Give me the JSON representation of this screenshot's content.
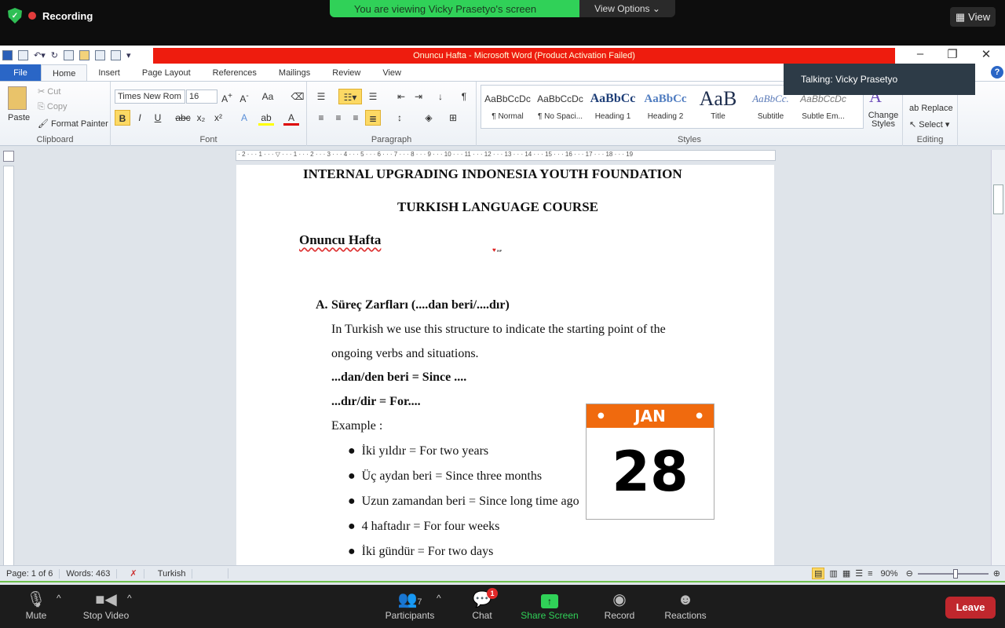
{
  "zoom_top": {
    "recording": "Recording",
    "banner": "You are viewing Vicky Prasetyo's screen",
    "view_options": "View Options",
    "view": "View"
  },
  "word": {
    "title": "Onuncu Hafta  -  Microsoft Word (Product Activation Failed)",
    "tabs": [
      "File",
      "Home",
      "Insert",
      "Page Layout",
      "References",
      "Mailings",
      "Review",
      "View"
    ],
    "clipboard": {
      "paste": "Paste",
      "cut": "Cut",
      "copy": "Copy",
      "format_painter": "Format Painter",
      "label": "Clipboard"
    },
    "font": {
      "name": "Times New Rom",
      "size": "16",
      "label": "Font"
    },
    "paragraph": {
      "label": "Paragraph"
    },
    "styles": {
      "items": [
        {
          "preview": "AaBbCcDc",
          "name": "¶ Normal"
        },
        {
          "preview": "AaBbCcDc",
          "name": "¶ No Spaci..."
        },
        {
          "preview": "AaBbCc",
          "name": "Heading 1"
        },
        {
          "preview": "AaBbCc",
          "name": "Heading 2"
        },
        {
          "preview": "AaB",
          "name": "Title"
        },
        {
          "preview": "AaBbCc.",
          "name": "Subtitle"
        },
        {
          "preview": "AaBbCcDc",
          "name": "Subtle Em..."
        }
      ],
      "change": "Change Styles",
      "label": "Styles"
    },
    "editing": {
      "replace": "Replace",
      "select": "Select",
      "label": "Editing"
    },
    "talking": "Talking: Vicky Prasetyo",
    "status": {
      "page": "Page: 1 of 6",
      "words": "Words: 463",
      "language": "Turkish",
      "zoom": "90%"
    }
  },
  "document": {
    "heading1": "INTERNAL UPGRADING INDONESIA YOUTH FOUNDATION",
    "heading2": "TURKISH LANGUAGE COURSE",
    "week": "Onuncu Hafta",
    "logo_text": "INDONESIA YOUTH FOUNDATION",
    "section_marker": "A.",
    "section_title": "Süreç Zarfları (....dan beri/....dır)",
    "para1": "In Turkish we use this structure to indicate the starting point of the",
    "para2": "ongoing verbs and situations.",
    "rule1": "...dan/den beri = Since ....",
    "rule2": "...dır/dir = For....",
    "example_label": "Example :",
    "examples": [
      "İki yıldır = For two years",
      "Üç aydan beri = Since three months",
      "Uzun zamandan beri = Since long time ago",
      "4 haftadır = For four weeks",
      "İki gündür = For two days"
    ],
    "calendar": {
      "month": "JAN",
      "day": "28"
    }
  },
  "zoom_bottom": {
    "mute": "Mute",
    "stop_video": "Stop Video",
    "participants": "Participants",
    "participants_count": "7",
    "chat": "Chat",
    "chat_badge": "1",
    "share": "Share Screen",
    "record": "Record",
    "reactions": "Reactions",
    "leave": "Leave"
  },
  "colors": {
    "share_green": "#30d158",
    "title_red": "#ee1c0e",
    "leave_red": "#c0272d",
    "calendar_orange": "#f06a0e"
  }
}
